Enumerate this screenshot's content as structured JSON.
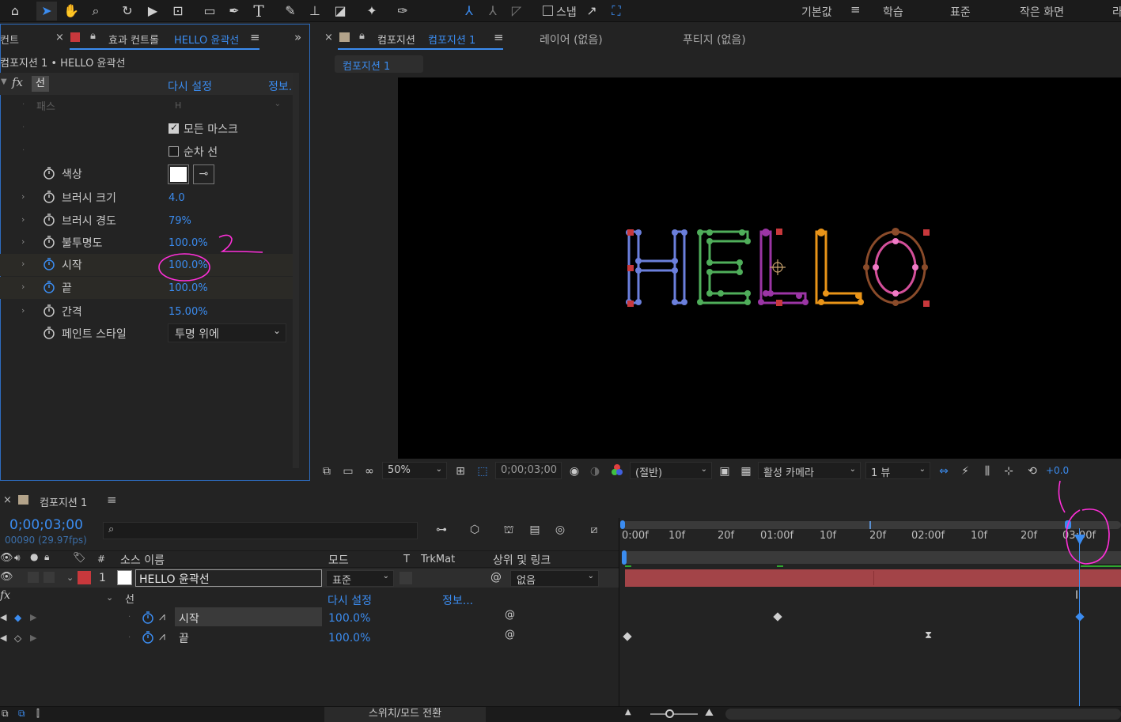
{
  "toolbar": {
    "snap_label": "스냅",
    "workspaces": [
      "기본값",
      "학습",
      "표준",
      "작은 화면",
      "라"
    ],
    "active_workspace_index": 0
  },
  "effects_panel": {
    "partial_tab": "컨트",
    "tab_title_prefix": "효과 컨트롤",
    "tab_title_layer": "HELLO 윤곽선",
    "breadcrumb": "컴포지션 1 • HELLO 윤곽선",
    "effect_fx": "fx",
    "effect_name": "선",
    "reset_label": "다시 설정",
    "info_label": "정보...",
    "path_label": "패스",
    "path_value": "H",
    "all_masks_label": "모든 마스크",
    "sequential_label": "순차 선",
    "props": [
      {
        "label": "색상",
        "value": ""
      },
      {
        "label": "브러시 크기",
        "value": "4.0"
      },
      {
        "label": "브러시 경도",
        "value": "79%"
      },
      {
        "label": "불투명도",
        "value": "100.0%"
      },
      {
        "label": "시작",
        "value": "100.0%"
      },
      {
        "label": "끝",
        "value": "100.0%"
      },
      {
        "label": "간격",
        "value": "15.00%"
      },
      {
        "label": "페인트 스타일",
        "value": "투명 위에"
      }
    ]
  },
  "comp_panel": {
    "tab_prefix": "컴포지션",
    "tab_comp": "컴포지션 1",
    "layer_tab": "레이어 (없음)",
    "footage_tab": "푸티지 (없음)",
    "subtab": "컴포지션 1",
    "preview_text": "HELLO",
    "zoom": "50%",
    "timecode": "0;00;03;00",
    "resolution": "(절반)",
    "camera": "활성 카메라",
    "views": "1 뷰",
    "exposure": "+0.0"
  },
  "timeline": {
    "tab": "컴포지션 1",
    "timecode": "0;00;03;00",
    "frames": "00090 (29.97fps)",
    "search_placeholder": "",
    "col_num": "#",
    "col_source": "소스 이름",
    "col_mode": "모드",
    "col_t": "T",
    "col_trkmat": "TrkMat",
    "col_parent": "상위 및 링크",
    "layer_index": "1",
    "layer_name": "HELLO 윤곽선",
    "layer_mode": "표준",
    "layer_parent": "없음",
    "effect_name": "선",
    "effect_fx": "fx",
    "reset_label": "다시 설정",
    "info_label": "정보...",
    "prop1_label": "시작",
    "prop1_value": "100.0%",
    "prop2_label": "끝",
    "prop2_value": "100.0%",
    "footer_toggle": "스위치/모드 전환",
    "ruler": [
      "0:00f",
      "10f",
      "20f",
      "01:00f",
      "10f",
      "20f",
      "02:00f",
      "10f",
      "20f",
      "03:00f"
    ]
  },
  "annotation_text": "2",
  "colors": {
    "accent": "#3b8cf0",
    "annotation": "#ff2fd9",
    "layer_bar": "#a34448",
    "label_red": "#c8383c",
    "letter_H": "#6b7fdc",
    "letter_E": "#4fae5a",
    "letter_L1": "#9b35a5",
    "letter_L2": "#e99418",
    "letter_O": "#8a4b2a"
  }
}
